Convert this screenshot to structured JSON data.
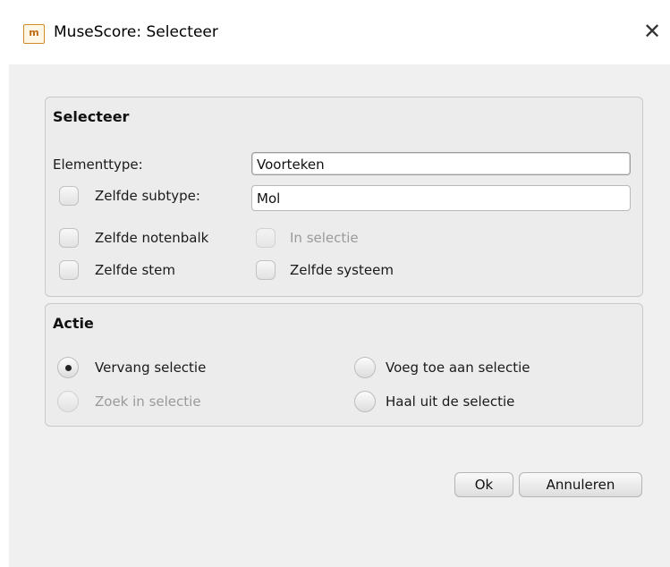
{
  "window": {
    "title": "MuseScore: Selecteer",
    "icon": "musescore-app-icon",
    "close_label": "✕"
  },
  "select_group": {
    "title": "Selecteer",
    "element_type_label": "Elementtype:",
    "element_type_value": "Voorteken",
    "same_subtype_label": "Zelfde subtype:",
    "subtype_value": "Mol",
    "same_staff_label": "Zelfde notenbalk",
    "in_selection_label": "In selectie",
    "same_voice_label": "Zelfde stem",
    "same_system_label": "Zelfde systeem"
  },
  "action_group": {
    "title": "Actie",
    "options": {
      "replace": "Vervang selectie",
      "add": "Voeg toe aan selectie",
      "search_in": "Zoek in selectie",
      "remove": "Haal uit de selectie"
    },
    "selected": "Vervang selectie"
  },
  "buttons": {
    "ok": "Ok",
    "cancel": "Annuleren"
  },
  "colors": {
    "client_bg": "#f0f0f0",
    "group_bg": "#ececec",
    "disabled_text": "#9a9a9a"
  }
}
